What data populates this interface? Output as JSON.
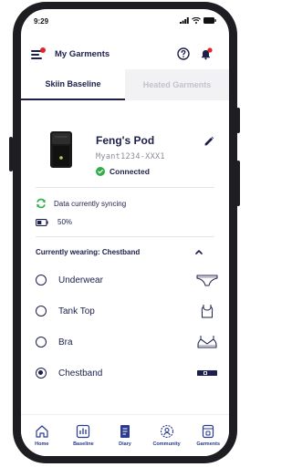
{
  "status_bar": {
    "time": "9:29"
  },
  "header": {
    "title": "My Garments"
  },
  "tabs": [
    {
      "label": "Skiin Baseline",
      "active": true
    },
    {
      "label": "Heated Garments",
      "active": false
    }
  ],
  "pod": {
    "name": "Feng's Pod",
    "serial": "Myant1234-XXX1",
    "status": "Connected",
    "status_color": "#2fae4a"
  },
  "sync": {
    "text": "Data currently syncing",
    "icon_color": "#2fae4a"
  },
  "battery": {
    "level_percent": 50,
    "text": "50%"
  },
  "wearing": {
    "label": "Currently wearing: Chestband"
  },
  "garments": [
    {
      "label": "Underwear",
      "icon": "underwear-icon",
      "selected": false
    },
    {
      "label": "Tank Top",
      "icon": "tank-top-icon",
      "selected": false
    },
    {
      "label": "Bra",
      "icon": "bra-icon",
      "selected": false
    },
    {
      "label": "Chestband",
      "icon": "chestband-icon",
      "selected": true
    }
  ],
  "nav": [
    {
      "label": "Home",
      "icon": "home-icon"
    },
    {
      "label": "Baseline",
      "icon": "baseline-chart-icon"
    },
    {
      "label": "Diary",
      "icon": "diary-icon"
    },
    {
      "label": "Community",
      "icon": "community-icon"
    },
    {
      "label": "Garments",
      "icon": "garments-icon"
    }
  ],
  "colors": {
    "primary": "#1c1f4a",
    "accent_red": "#e0242b",
    "nav_blue": "#2a3a8c"
  }
}
